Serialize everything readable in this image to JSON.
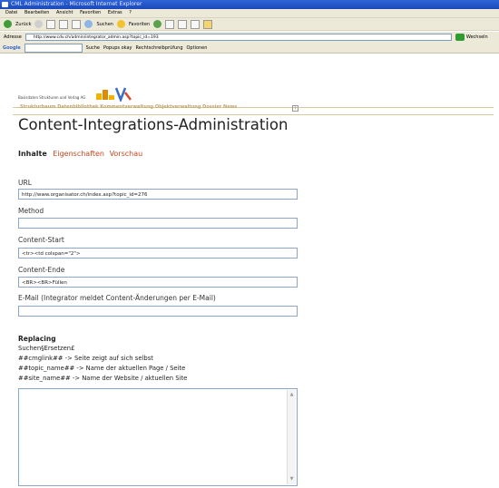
{
  "browser": {
    "title": "CML Administration - Microsoft Internet Explorer",
    "menu": [
      "Datei",
      "Bearbeiten",
      "Ansicht",
      "Favoriten",
      "Extras",
      "?"
    ],
    "toolbar": {
      "back": "Zurück",
      "search": "Suchen",
      "favorites": "Favoriten"
    },
    "address_label": "Adresse",
    "address_value": "http://www.cdv.ch/admin/integrator_admin.asp?topic_id=193",
    "go_label": "Wechseln",
    "google_label": "Google",
    "google_items": [
      "Suche",
      "Popups okay",
      "Rechtschreibprüfung",
      "Optionen"
    ]
  },
  "page": {
    "org_text": "Basisdaten Strukturen und Verlag AG",
    "nav_text": "Strukturbaum Datenbibliothek Kommentverwaltung Objektverwaltung Dossier News",
    "title": "Content-Integrations-Administration",
    "tabs": {
      "active": "Inhalte",
      "items": [
        "Eigenschaften",
        "Vorschau"
      ]
    },
    "fields": {
      "url_label": "URL",
      "url_value": "http://www.organisator.ch/index.asp?topic_id=276",
      "method_label": "Method",
      "method_value": "",
      "start_label": "Content-Start",
      "start_value": "<tr><td colspan=\"2\">",
      "end_label": "Content-Ende",
      "end_value": "<BR><BR>Füllen",
      "email_label": "E-Mail (Integrator meldet Content-Änderungen per E-Mail)",
      "email_value": ""
    },
    "replacing": {
      "title": "Replacing",
      "header": "Suchen§Ersetzen£",
      "lines": [
        "##cmglink## -> Seite zeigt auf sich selbst",
        "##topic_name## -> Name der aktuellen Page / Seite",
        "##site_name## -> Name der Website / aktuellen Site"
      ]
    }
  },
  "colors": {
    "link": "#c1481f",
    "field_border": "#8aa6c9",
    "titlebar": "#2f64d8"
  }
}
